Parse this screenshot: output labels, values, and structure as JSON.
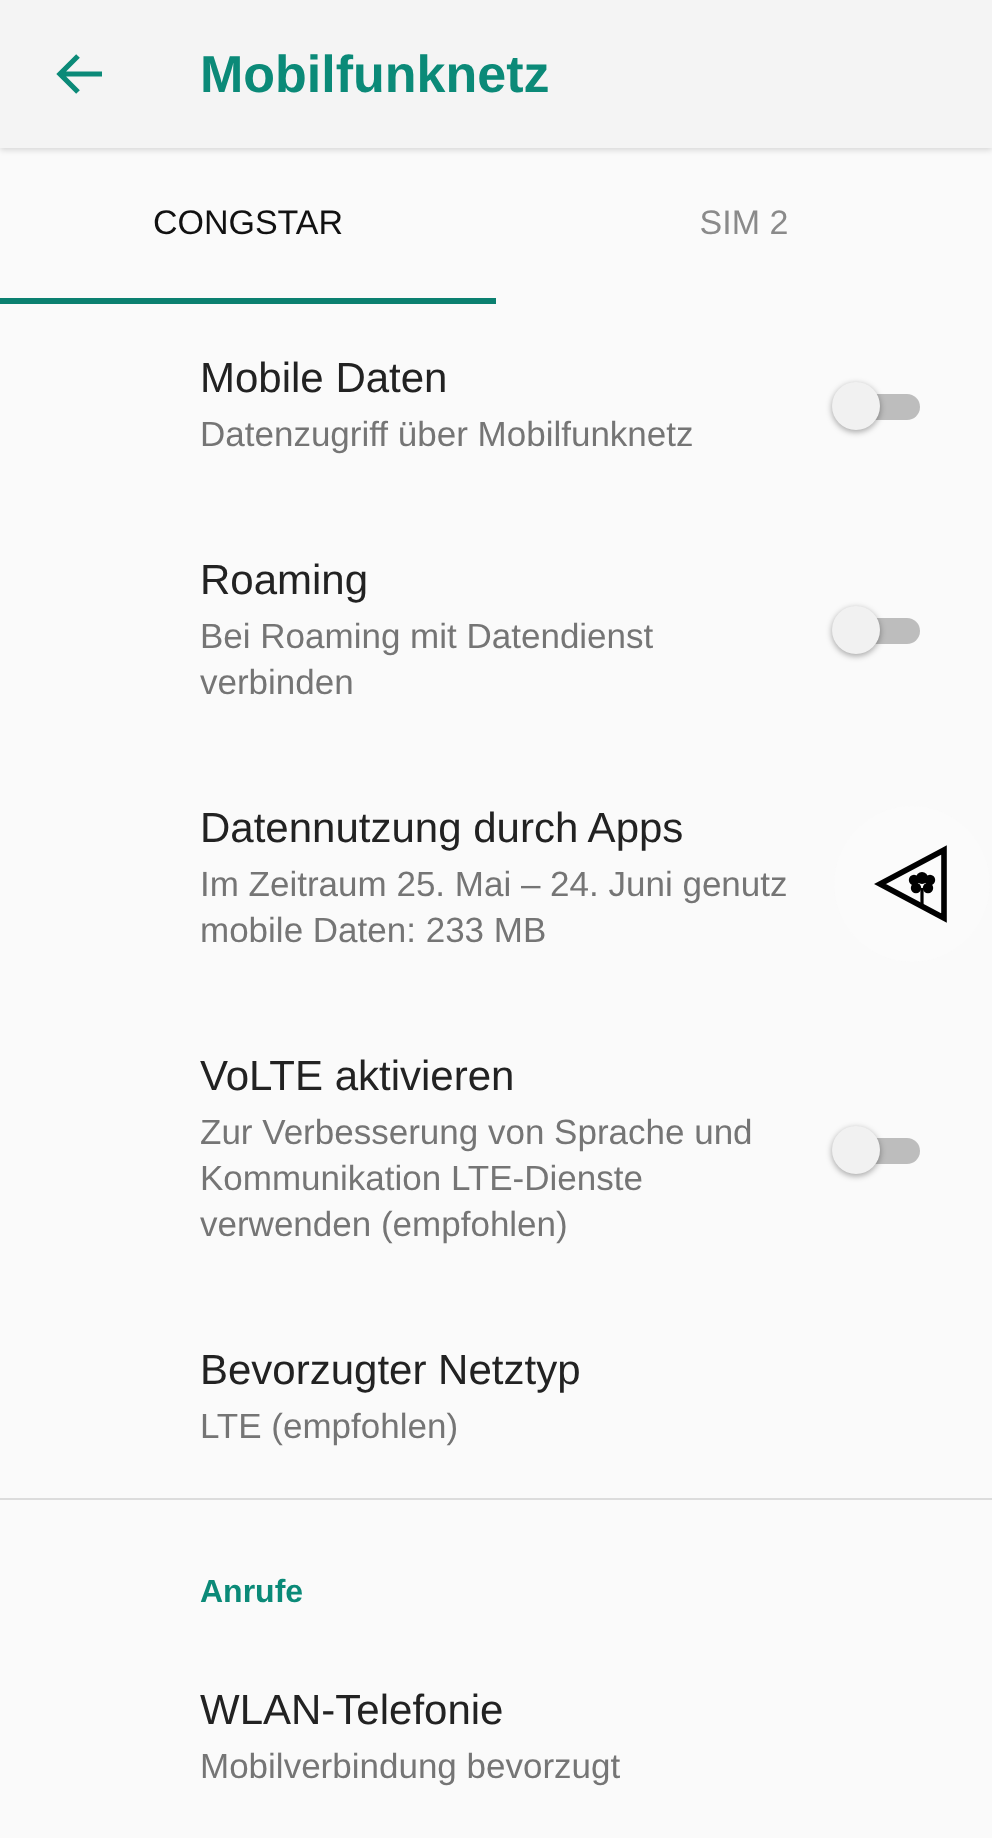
{
  "app_bar": {
    "title": "Mobilfunknetz"
  },
  "tabs": [
    {
      "label": "CONGSTAR",
      "selected": true
    },
    {
      "label": "SIM 2",
      "selected": false
    }
  ],
  "settings": [
    {
      "kind": "switch",
      "title": "Mobile Daten",
      "summary": "Datenzugriff über Mobilfunknetz",
      "on": false
    },
    {
      "kind": "switch",
      "title": "Roaming",
      "summary": "Bei Roaming mit Datendienst verbinden",
      "on": false
    },
    {
      "kind": "link",
      "title": "Datennutzung durch Apps",
      "summary_lines": [
        "Im Zeitraum 25. Mai – 24. Juni genutz",
        "mobile Daten: 233 MB"
      ]
    },
    {
      "kind": "switch",
      "title": "VoLTE aktivieren",
      "summary": "Zur Verbesserung von Sprache und Kommunikation LTE-Dienste verwenden (empfohlen)",
      "on": false
    },
    {
      "kind": "link",
      "title": "Bevorzugter Netztyp",
      "summary": "LTE (empfohlen)"
    },
    {
      "kind": "divider"
    },
    {
      "kind": "header",
      "title": "Anrufe"
    },
    {
      "kind": "link",
      "title": "WLAN-Telefonie",
      "summary": "Mobilverbindung bevorzugt"
    }
  ]
}
